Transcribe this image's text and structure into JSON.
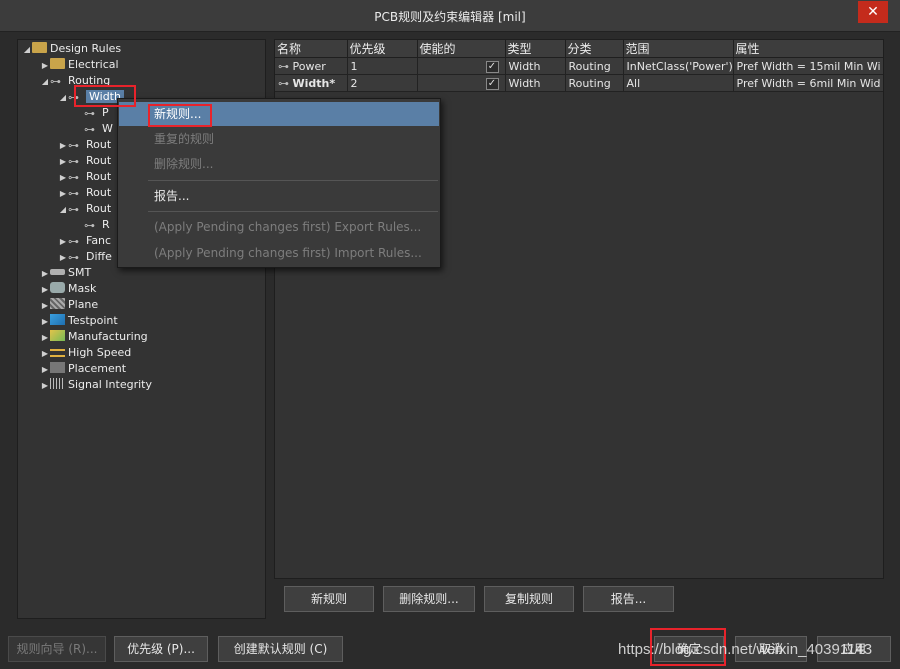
{
  "window": {
    "title": "PCB规则及约束编辑器 [mil]",
    "close_glyph": "✕"
  },
  "tree": {
    "root": "Design Rules",
    "items": [
      {
        "label": "Electrical"
      },
      {
        "label": "Routing"
      },
      {
        "label": "Width"
      },
      {
        "label": "P"
      },
      {
        "label": "W"
      },
      {
        "label": "Rout"
      },
      {
        "label": "Rout"
      },
      {
        "label": "Rout"
      },
      {
        "label": "Rout"
      },
      {
        "label": "Rout"
      },
      {
        "label": "R"
      },
      {
        "label": "Fanc"
      },
      {
        "label": "Diffe"
      },
      {
        "label": "SMT"
      },
      {
        "label": "Mask"
      },
      {
        "label": "Plane"
      },
      {
        "label": "Testpoint"
      },
      {
        "label": "Manufacturing"
      },
      {
        "label": "High Speed"
      },
      {
        "label": "Placement"
      },
      {
        "label": "Signal Integrity"
      }
    ]
  },
  "grid": {
    "headers": [
      "名称",
      "优先级",
      "使能的",
      "类型",
      "分类",
      "范围",
      "属性"
    ],
    "rows": [
      {
        "name": "Power",
        "priority": "1",
        "enabled": "✓",
        "type": "Width",
        "category": "Routing",
        "scope": "InNetClass('Power')",
        "attrs": "Pref Width = 15mil   Min Wi"
      },
      {
        "name": "Width*",
        "priority": "2",
        "enabled": "✓",
        "type": "Width",
        "category": "Routing",
        "scope": "All",
        "attrs": "Pref Width = 6mil    Min Wid"
      }
    ]
  },
  "context_menu": {
    "new_rule": "新规则...",
    "duplicate_rule": "重复的规则",
    "delete_rule": "删除规则...",
    "report": "报告...",
    "export_rules": "(Apply Pending changes first) Export Rules...",
    "import_rules": "(Apply Pending changes first) Import Rules..."
  },
  "panel_buttons": {
    "new_rule": "新规则",
    "delete_rule": "删除规则...",
    "copy_rule": "复制规则",
    "report": "报告..."
  },
  "bottom_buttons": {
    "wizard": "规则向导 (R)...",
    "priorities": "优先级 (P)...",
    "create_default": "创建默认规则 (C)",
    "ok": "确定",
    "cancel": "取消",
    "apply": "应用"
  },
  "watermark": "https://blog.csdn.net/weixin_40391143",
  "colors": {
    "highlight": "#5a7fa6",
    "annotation_red": "#e8232b"
  }
}
